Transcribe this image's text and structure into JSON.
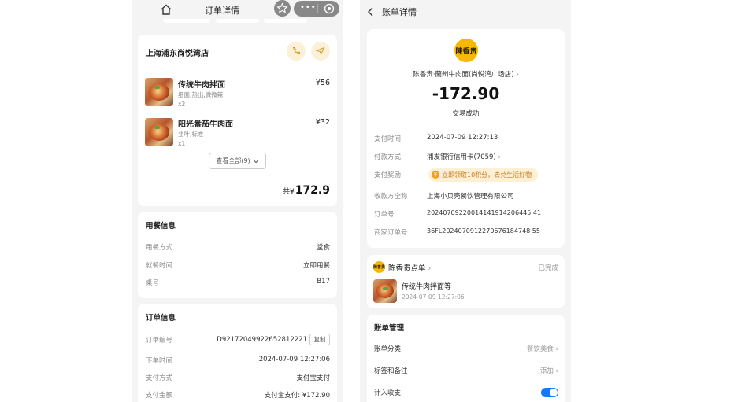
{
  "left": {
    "header": {
      "title": "订单详情"
    },
    "store": {
      "name": "上海浦东尚悦湾店"
    },
    "items": [
      {
        "name": "传统牛肉拌面",
        "spec": "细面,热出,微微辣",
        "qty": "x2",
        "price": "¥56"
      },
      {
        "name": "阳光番茄牛肉面",
        "spec": "韭叶,标准",
        "qty": "x1",
        "price": "¥32"
      }
    ],
    "view_all": "查看全部(9)",
    "total_prefix": "共¥",
    "total": "172.9",
    "dining": {
      "title": "用餐信息",
      "rows": [
        {
          "label": "用餐方式",
          "value": "堂食"
        },
        {
          "label": "就餐时间",
          "value": "立即用餐"
        },
        {
          "label": "桌号",
          "value": "B17"
        }
      ]
    },
    "order": {
      "title": "订单信息",
      "rows": [
        {
          "label": "订单编号",
          "value": "D92172049922652812221"
        },
        {
          "label": "下单时间",
          "value": "2024-07-09 12:27:06"
        },
        {
          "label": "支付方式",
          "value": "支付宝支付"
        },
        {
          "label": "支付金额",
          "value": "支付宝支付: ¥172.90"
        }
      ],
      "copy_label": "复制"
    }
  },
  "right": {
    "header": {
      "title": "账单详情"
    },
    "logo_text": "陳香贵",
    "merchant": "陈香贵·蘭州牛肉面(尚悦湾广场店)",
    "amount": "-172.90",
    "status": "交易成功",
    "rows": [
      {
        "label": "支付时间",
        "value": "2024-07-09 12:27:13"
      },
      {
        "label": "付款方式",
        "value": "浦发银行信用卡(7059)"
      },
      {
        "label": "支付奖励",
        "value": "立即领取10积分，去兑生活好物"
      },
      {
        "label": "收款方全称",
        "value": "上海小贝壳餐饮管理有限公司"
      },
      {
        "label": "订单号",
        "value": "20240709220014141914206445 41"
      },
      {
        "label": "商家订单号",
        "value": "36FL2024070912270676184748 55"
      }
    ],
    "order_card": {
      "logo_text": "陳香贵",
      "title": "陈香贵点单",
      "status": "已完成",
      "item": "传统牛肉拌面等",
      "time": "2024-07-09 12:27:06"
    },
    "bill_mgmt": {
      "title": "账单管理",
      "rows": [
        {
          "label": "账单分类",
          "value": "餐饮美食"
        },
        {
          "label": "标签和备注",
          "value": "添加"
        },
        {
          "label": "计入收支",
          "value": ""
        }
      ]
    }
  },
  "colors": {
    "accent_blue": "#1677ff",
    "logo_yellow": "#f6b800",
    "reward_orange": "#c8781a"
  }
}
